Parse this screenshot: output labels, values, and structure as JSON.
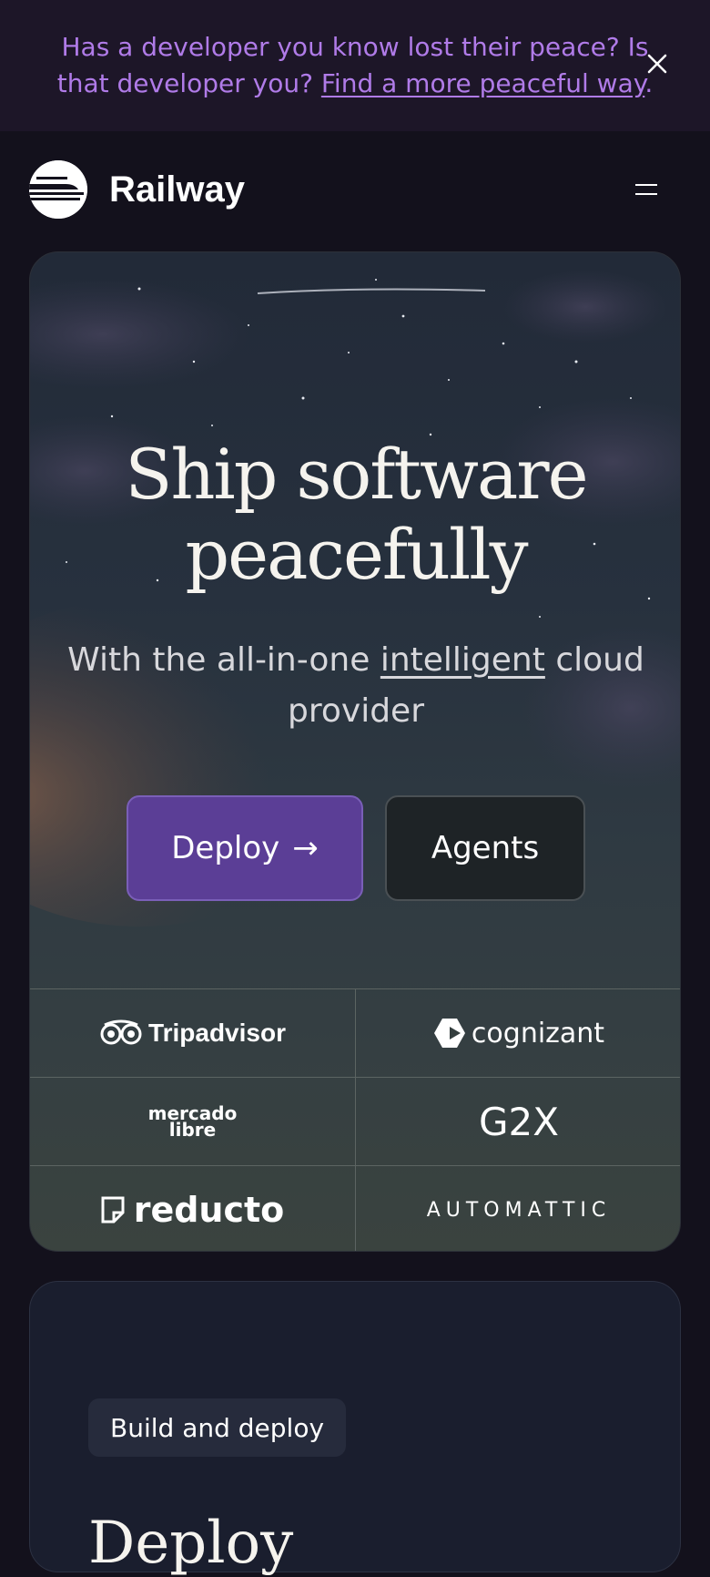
{
  "banner": {
    "text_before": "Has a developer you know lost their peace? Is that developer you? ",
    "link_text": "Find a more peaceful way",
    "text_after": ".",
    "close_icon": "close-icon"
  },
  "header": {
    "brand": "Railway",
    "logo_icon": "railway-logo-icon",
    "menu_icon": "hamburger-menu-icon"
  },
  "hero": {
    "title_line1": "Ship software",
    "title_line2": "peacefully",
    "subtitle_before": "With the all-in-one ",
    "subtitle_link": "intelligent",
    "subtitle_after": " cloud provider",
    "deploy_label": "Deploy",
    "deploy_arrow": "→",
    "agents_label": "Agents"
  },
  "logos": {
    "tripadvisor": "Tripadvisor",
    "cognizant": "cognizant",
    "mercado_line1": "mercado",
    "mercado_line2": "libre",
    "g2x": "G2X",
    "reducto": "reducto",
    "automattic": "AUTOMATTIC"
  },
  "section2": {
    "pill": "Build and deploy",
    "heading": "Deploy"
  },
  "colors": {
    "banner_text": "#b07be8",
    "deploy_button": "#5b3e96",
    "page_bg": "#13111c"
  }
}
